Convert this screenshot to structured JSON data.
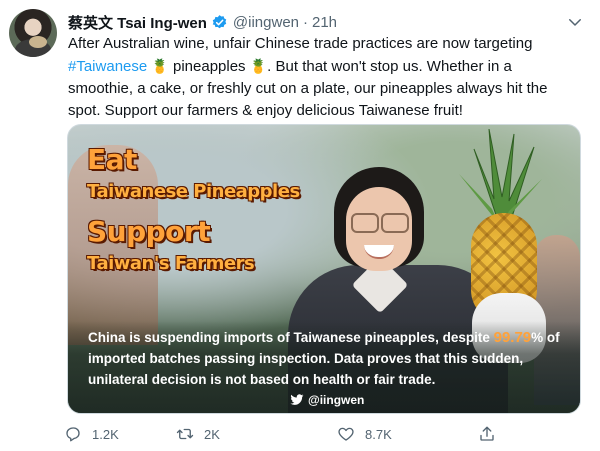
{
  "tweet": {
    "display_name": "蔡英文 Tsai Ing-wen",
    "handle": "@iingwen",
    "separator": "·",
    "time": "21h",
    "text_line1": "After Australian wine, unfair Chinese trade practices are now targeting",
    "hashtag": "#Taiwanese",
    "emoji_pineapple": "🍍",
    "text_pineapples": " pineapples ",
    "text_line2_rest": ". But that won't stop us. Whether in a smoothie, a cake, or freshly cut on a plate, our pineapples always hit the spot. Support our farmers & enjoy delicious Taiwanese fruit!"
  },
  "media": {
    "line_eat": "Eat",
    "line_taiwanese_pineapples": "Taiwanese Pineapples",
    "line_support": "Support",
    "line_farmers": "Taiwan's Farmers",
    "caption_part1": "China is suspending imports of Taiwanese pineapples, despite",
    "caption_pct": "99.79",
    "caption_part2": "% of imported batches passing inspection. Data proves that this sudden, unilateral decision is not based on health or fair trade.",
    "watermark": "@iingwen"
  },
  "actions": {
    "reply_count": "1.2K",
    "retweet_count": "2K",
    "like_count": "8.7K"
  },
  "colors": {
    "link": "#1d9bf0",
    "muted": "#536471",
    "overlay_orange": "#ffa23a"
  }
}
